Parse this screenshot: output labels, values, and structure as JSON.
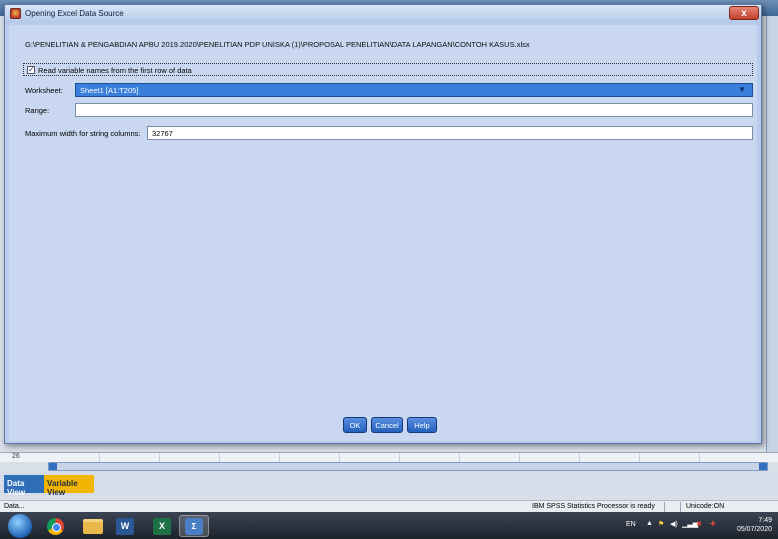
{
  "dialog": {
    "title": "Opening Excel Data Source",
    "close_label": "x",
    "file_path": "G:\\PENELITIAN & PENGABDIAN APBU 2019.2020\\PENELITIAN PDP UNISKA (1)\\PROPOSAL PENELITIAN\\DATA LAPANGAN\\CONTOH KASUS.xlsx",
    "read_names_label": "Read variable names from the first row of data",
    "read_names_checked": true,
    "worksheet_label": "Worksheet:",
    "worksheet_value": "Sheet1 [A1:T205]",
    "range_label": "Range:",
    "range_value": "",
    "max_width_label": "Maximum width for string columns:",
    "max_width_value": "32767",
    "ok_label": "OK",
    "cancel_label": "Cancel",
    "help_label": "Help"
  },
  "spss": {
    "row_number": "26",
    "tabs": {
      "data_view": "Data View",
      "variable_view": "Variable View"
    },
    "status": {
      "left": "Data...",
      "processor": "IBM SPSS Statistics Processor is ready",
      "unicode": "Unicode:ON"
    }
  },
  "taskbar": {
    "word_label": "W",
    "excel_label": "X",
    "spss_label": "Σ",
    "tray_lang": "EN",
    "clock_time": "7:49",
    "clock_date": "05/07/2020"
  },
  "icons": [
    "windows-start-icon",
    "chrome-icon",
    "folder-icon",
    "word-icon",
    "excel-icon",
    "spss-icon",
    "checkbox-check-icon",
    "chevron-down-icon",
    "close-icon"
  ],
  "colors": {
    "accent": "#3a7fdb",
    "dialog_bg": "#c9d7f0",
    "variable_view_tab": "#f1b400"
  }
}
